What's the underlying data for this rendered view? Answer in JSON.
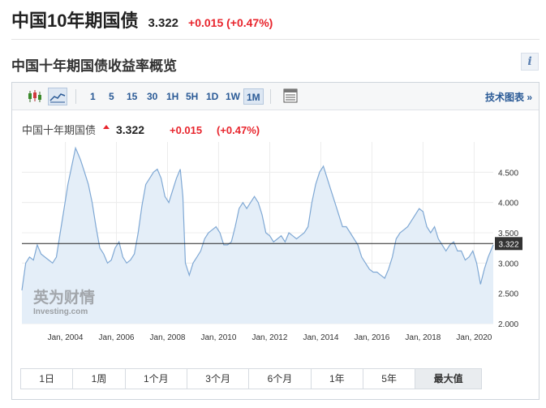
{
  "header": {
    "title": "中国10年期国债",
    "price": "3.322",
    "change": "+0.015 (+0.47%)"
  },
  "section": {
    "title": "中国十年期国债收益率概览",
    "info_icon": "info-icon"
  },
  "toolbar": {
    "chart_type_icons": [
      "candlestick-icon",
      "area-chart-icon"
    ],
    "intervals": [
      "1",
      "5",
      "15",
      "30",
      "1H",
      "5H",
      "1D",
      "1W",
      "1M"
    ],
    "selected_interval": "1M",
    "table_icon": "table-icon",
    "tech_chart": "技术图表 »"
  },
  "chart_data": {
    "type": "area",
    "legend": {
      "name": "中国十年期国债",
      "price": "3.322",
      "change": "+0.015",
      "pct": "(+0.47%)"
    },
    "x_tick_labels": [
      "Jan, 2004",
      "Jan, 2006",
      "Jan, 2008",
      "Jan, 2010",
      "Jan, 2012",
      "Jan, 2014",
      "Jan, 2016",
      "Jan, 2018",
      "Jan, 2020"
    ],
    "y_ticks": [
      2.0,
      2.5,
      3.0,
      3.5,
      4.0,
      4.5
    ],
    "y_tick_labels": [
      "2.000",
      "2.500",
      "3.000",
      "3.500",
      "4.000",
      "4.500"
    ],
    "ylim": [
      2.0,
      5.0
    ],
    "xlim": [
      2002.3,
      2020.75
    ],
    "current_value": 3.322,
    "current_label": "3.322",
    "grid": true,
    "watermark": "英为财情 Investing.com",
    "series": [
      {
        "x": [
          2002.3,
          2002.45,
          2002.6,
          2002.75,
          2002.9,
          2003.05,
          2003.2,
          2003.35,
          2003.5,
          2003.65,
          2003.8,
          2003.95,
          2004.1,
          2004.25,
          2004.4,
          2004.5,
          2004.6,
          2004.75,
          2004.9,
          2005.05,
          2005.2,
          2005.35,
          2005.5,
          2005.65,
          2005.8,
          2005.95,
          2006.1,
          2006.25,
          2006.4,
          2006.55,
          2006.7,
          2006.85,
          2007.0,
          2007.15,
          2007.3,
          2007.45,
          2007.6,
          2007.75,
          2007.9,
          2008.05,
          2008.2,
          2008.35,
          2008.5,
          2008.6,
          2008.7,
          2008.85,
          2009.0,
          2009.15,
          2009.3,
          2009.45,
          2009.6,
          2009.75,
          2009.9,
          2010.05,
          2010.2,
          2010.35,
          2010.5,
          2010.65,
          2010.8,
          2010.95,
          2011.1,
          2011.25,
          2011.4,
          2011.55,
          2011.7,
          2011.85,
          2012.0,
          2012.15,
          2012.3,
          2012.45,
          2012.6,
          2012.75,
          2012.9,
          2013.05,
          2013.2,
          2013.35,
          2013.5,
          2013.65,
          2013.8,
          2013.95,
          2014.1,
          2014.25,
          2014.4,
          2014.55,
          2014.7,
          2014.85,
          2015.0,
          2015.15,
          2015.3,
          2015.45,
          2015.6,
          2015.75,
          2015.9,
          2016.05,
          2016.2,
          2016.35,
          2016.5,
          2016.65,
          2016.8,
          2016.95,
          2017.1,
          2017.25,
          2017.4,
          2017.55,
          2017.7,
          2017.85,
          2018.0,
          2018.15,
          2018.3,
          2018.45,
          2018.6,
          2018.75,
          2018.9,
          2019.05,
          2019.2,
          2019.35,
          2019.5,
          2019.65,
          2019.8,
          2019.95,
          2020.1,
          2020.25,
          2020.4,
          2020.55,
          2020.75
        ],
        "values": [
          2.55,
          3.0,
          3.1,
          3.05,
          3.3,
          3.15,
          3.1,
          3.05,
          3.0,
          3.1,
          3.5,
          3.9,
          4.3,
          4.6,
          4.9,
          4.8,
          4.7,
          4.5,
          4.3,
          4.0,
          3.6,
          3.25,
          3.15,
          3.0,
          3.05,
          3.25,
          3.35,
          3.1,
          3.0,
          3.05,
          3.15,
          3.5,
          3.95,
          4.3,
          4.4,
          4.5,
          4.55,
          4.4,
          4.1,
          4.0,
          4.2,
          4.4,
          4.55,
          4.1,
          3.0,
          2.8,
          3.0,
          3.1,
          3.2,
          3.4,
          3.5,
          3.55,
          3.6,
          3.5,
          3.3,
          3.3,
          3.35,
          3.6,
          3.9,
          4.0,
          3.9,
          4.0,
          4.1,
          4.0,
          3.8,
          3.5,
          3.45,
          3.35,
          3.4,
          3.45,
          3.35,
          3.5,
          3.45,
          3.4,
          3.45,
          3.5,
          3.6,
          4.0,
          4.3,
          4.5,
          4.6,
          4.4,
          4.2,
          4.0,
          3.8,
          3.6,
          3.6,
          3.5,
          3.4,
          3.3,
          3.1,
          3.0,
          2.9,
          2.85,
          2.85,
          2.8,
          2.75,
          2.9,
          3.1,
          3.4,
          3.5,
          3.55,
          3.6,
          3.7,
          3.8,
          3.9,
          3.85,
          3.6,
          3.5,
          3.6,
          3.4,
          3.3,
          3.2,
          3.3,
          3.35,
          3.2,
          3.2,
          3.05,
          3.1,
          3.2,
          3.0,
          2.65,
          2.9,
          3.1,
          3.3
        ]
      }
    ]
  },
  "periods": {
    "items": [
      "1日",
      "1周",
      "1个月",
      "3个月",
      "6个月",
      "1年",
      "5年",
      "最大值"
    ],
    "selected": "最大值"
  }
}
